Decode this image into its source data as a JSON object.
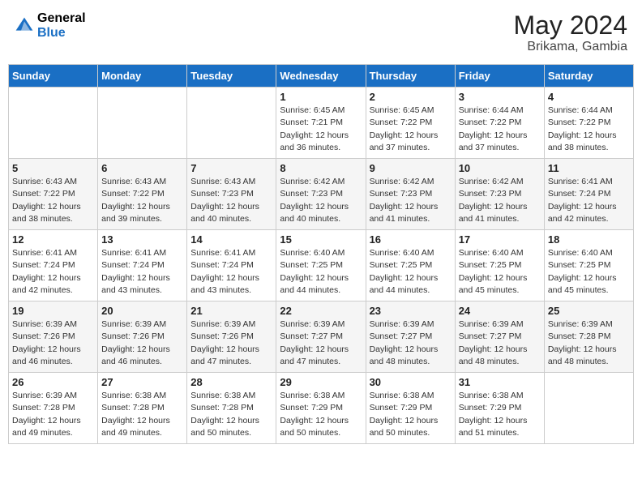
{
  "header": {
    "logo_line1": "General",
    "logo_line2": "Blue",
    "month": "May 2024",
    "location": "Brikama, Gambia"
  },
  "weekdays": [
    "Sunday",
    "Monday",
    "Tuesday",
    "Wednesday",
    "Thursday",
    "Friday",
    "Saturday"
  ],
  "weeks": [
    [
      {
        "day": "",
        "info": ""
      },
      {
        "day": "",
        "info": ""
      },
      {
        "day": "",
        "info": ""
      },
      {
        "day": "1",
        "info": "Sunrise: 6:45 AM\nSunset: 7:21 PM\nDaylight: 12 hours\nand 36 minutes."
      },
      {
        "day": "2",
        "info": "Sunrise: 6:45 AM\nSunset: 7:22 PM\nDaylight: 12 hours\nand 37 minutes."
      },
      {
        "day": "3",
        "info": "Sunrise: 6:44 AM\nSunset: 7:22 PM\nDaylight: 12 hours\nand 37 minutes."
      },
      {
        "day": "4",
        "info": "Sunrise: 6:44 AM\nSunset: 7:22 PM\nDaylight: 12 hours\nand 38 minutes."
      }
    ],
    [
      {
        "day": "5",
        "info": "Sunrise: 6:43 AM\nSunset: 7:22 PM\nDaylight: 12 hours\nand 38 minutes."
      },
      {
        "day": "6",
        "info": "Sunrise: 6:43 AM\nSunset: 7:22 PM\nDaylight: 12 hours\nand 39 minutes."
      },
      {
        "day": "7",
        "info": "Sunrise: 6:43 AM\nSunset: 7:23 PM\nDaylight: 12 hours\nand 40 minutes."
      },
      {
        "day": "8",
        "info": "Sunrise: 6:42 AM\nSunset: 7:23 PM\nDaylight: 12 hours\nand 40 minutes."
      },
      {
        "day": "9",
        "info": "Sunrise: 6:42 AM\nSunset: 7:23 PM\nDaylight: 12 hours\nand 41 minutes."
      },
      {
        "day": "10",
        "info": "Sunrise: 6:42 AM\nSunset: 7:23 PM\nDaylight: 12 hours\nand 41 minutes."
      },
      {
        "day": "11",
        "info": "Sunrise: 6:41 AM\nSunset: 7:24 PM\nDaylight: 12 hours\nand 42 minutes."
      }
    ],
    [
      {
        "day": "12",
        "info": "Sunrise: 6:41 AM\nSunset: 7:24 PM\nDaylight: 12 hours\nand 42 minutes."
      },
      {
        "day": "13",
        "info": "Sunrise: 6:41 AM\nSunset: 7:24 PM\nDaylight: 12 hours\nand 43 minutes."
      },
      {
        "day": "14",
        "info": "Sunrise: 6:41 AM\nSunset: 7:24 PM\nDaylight: 12 hours\nand 43 minutes."
      },
      {
        "day": "15",
        "info": "Sunrise: 6:40 AM\nSunset: 7:25 PM\nDaylight: 12 hours\nand 44 minutes."
      },
      {
        "day": "16",
        "info": "Sunrise: 6:40 AM\nSunset: 7:25 PM\nDaylight: 12 hours\nand 44 minutes."
      },
      {
        "day": "17",
        "info": "Sunrise: 6:40 AM\nSunset: 7:25 PM\nDaylight: 12 hours\nand 45 minutes."
      },
      {
        "day": "18",
        "info": "Sunrise: 6:40 AM\nSunset: 7:25 PM\nDaylight: 12 hours\nand 45 minutes."
      }
    ],
    [
      {
        "day": "19",
        "info": "Sunrise: 6:39 AM\nSunset: 7:26 PM\nDaylight: 12 hours\nand 46 minutes."
      },
      {
        "day": "20",
        "info": "Sunrise: 6:39 AM\nSunset: 7:26 PM\nDaylight: 12 hours\nand 46 minutes."
      },
      {
        "day": "21",
        "info": "Sunrise: 6:39 AM\nSunset: 7:26 PM\nDaylight: 12 hours\nand 47 minutes."
      },
      {
        "day": "22",
        "info": "Sunrise: 6:39 AM\nSunset: 7:27 PM\nDaylight: 12 hours\nand 47 minutes."
      },
      {
        "day": "23",
        "info": "Sunrise: 6:39 AM\nSunset: 7:27 PM\nDaylight: 12 hours\nand 48 minutes."
      },
      {
        "day": "24",
        "info": "Sunrise: 6:39 AM\nSunset: 7:27 PM\nDaylight: 12 hours\nand 48 minutes."
      },
      {
        "day": "25",
        "info": "Sunrise: 6:39 AM\nSunset: 7:28 PM\nDaylight: 12 hours\nand 48 minutes."
      }
    ],
    [
      {
        "day": "26",
        "info": "Sunrise: 6:39 AM\nSunset: 7:28 PM\nDaylight: 12 hours\nand 49 minutes."
      },
      {
        "day": "27",
        "info": "Sunrise: 6:38 AM\nSunset: 7:28 PM\nDaylight: 12 hours\nand 49 minutes."
      },
      {
        "day": "28",
        "info": "Sunrise: 6:38 AM\nSunset: 7:28 PM\nDaylight: 12 hours\nand 50 minutes."
      },
      {
        "day": "29",
        "info": "Sunrise: 6:38 AM\nSunset: 7:29 PM\nDaylight: 12 hours\nand 50 minutes."
      },
      {
        "day": "30",
        "info": "Sunrise: 6:38 AM\nSunset: 7:29 PM\nDaylight: 12 hours\nand 50 minutes."
      },
      {
        "day": "31",
        "info": "Sunrise: 6:38 AM\nSunset: 7:29 PM\nDaylight: 12 hours\nand 51 minutes."
      },
      {
        "day": "",
        "info": ""
      }
    ]
  ]
}
